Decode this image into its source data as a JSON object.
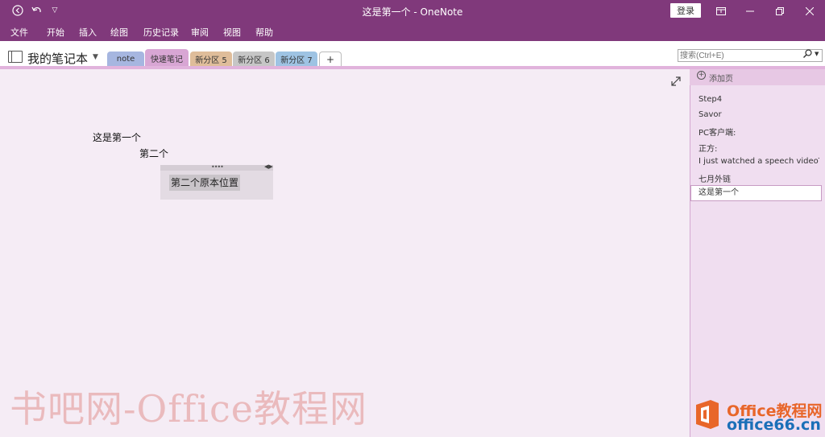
{
  "titlebar": {
    "title": "这是第一个  -  OneNote",
    "login": "登录",
    "back_icon": "back-circle-icon",
    "undo_icon": "undo-icon",
    "customize_icon": "chevron-down-icon"
  },
  "menu": {
    "items": [
      "文件",
      "开始",
      "插入",
      "绘图",
      "历史记录",
      "审阅",
      "视图",
      "帮助"
    ]
  },
  "notebook": {
    "name": "我的笔记本"
  },
  "sections": [
    {
      "label": "note",
      "color": "#a6b6e0"
    },
    {
      "label": "快速笔记",
      "color": "#d8a6d4"
    },
    {
      "label": "新分区 5",
      "color": "#dfbd9a"
    },
    {
      "label": "新分区 6",
      "color": "#c6c6c6"
    },
    {
      "label": "新分区 7",
      "color": "#9ec3e3"
    },
    {
      "label": "+",
      "color": "#ffffff"
    }
  ],
  "search": {
    "placeholder": "搜索(Ctrl+E)"
  },
  "note": {
    "line1": "这是第一个",
    "line2": "第二个",
    "container_text": "第二个原本位置"
  },
  "pages": {
    "add_label": "添加页",
    "items": [
      "Step4",
      "Savor",
      "PC客户端:",
      "正方:",
      "I just watched a speech videoTh",
      "七月外链",
      "这是第一个"
    ]
  },
  "watermark": {
    "left_text": "书吧网-Office教程网",
    "logo_line1": "Office教程网",
    "logo_line2": "office66.cn"
  }
}
